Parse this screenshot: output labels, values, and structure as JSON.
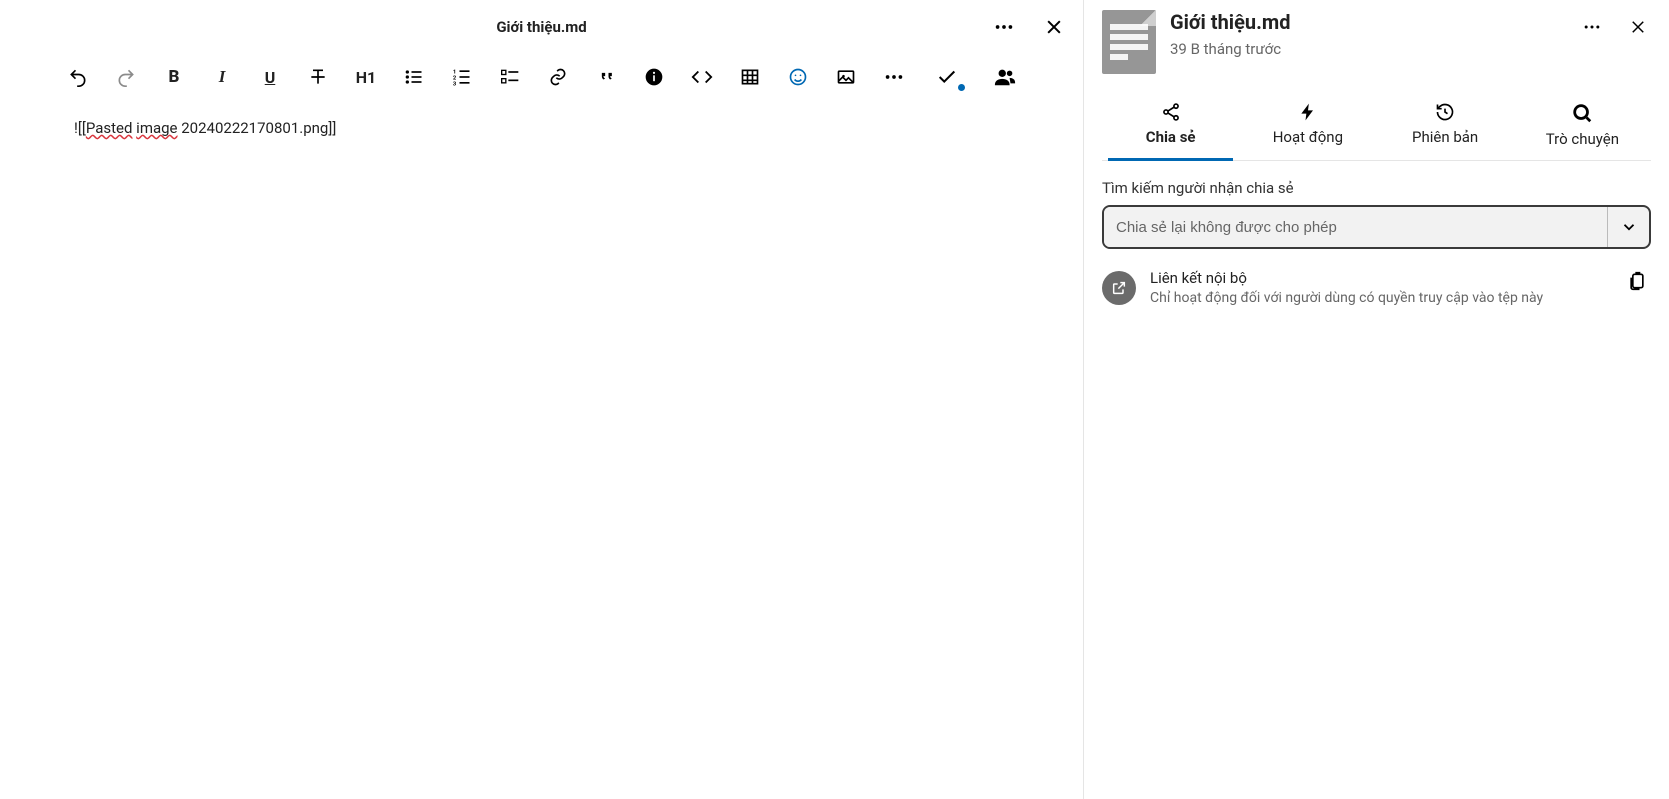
{
  "editor": {
    "title": "Giới thiệu.md",
    "content_prefix": "![[",
    "content_spell1": "Pasted",
    "content_mid": " ",
    "content_spell2": "image",
    "content_suffix": " 20240222170801.png]]",
    "heading_label": "H1"
  },
  "panel": {
    "title": "Giới thiệu.md",
    "subtitle": "39 B tháng trước",
    "tabs": {
      "share": "Chia sẻ",
      "activity": "Hoạt động",
      "versions": "Phiên bản",
      "chat": "Trò chuyện"
    },
    "search_label": "Tìm kiếm người nhận chia sẻ",
    "search_placeholder": "Chia sẻ lại không được cho phép",
    "internal_link": {
      "title": "Liên kết nội bộ",
      "desc": "Chỉ hoạt động đối với người dùng có quyền truy cập vào tệp này"
    }
  }
}
